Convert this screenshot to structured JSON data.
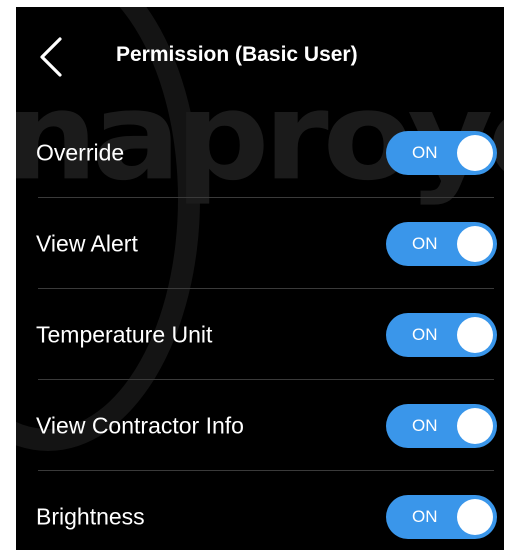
{
  "header": {
    "title": "Permission (Basic User)",
    "back_icon": "chevron-left-icon"
  },
  "watermark": "naproyec",
  "accent_color": "#3a96ea",
  "permissions": [
    {
      "label": "Override",
      "toggle_text": "ON",
      "enabled": true
    },
    {
      "label": "View Alert",
      "toggle_text": "ON",
      "enabled": true
    },
    {
      "label": "Temperature Unit",
      "toggle_text": "ON",
      "enabled": true
    },
    {
      "label": "View Contractor Info",
      "toggle_text": "ON",
      "enabled": true
    },
    {
      "label": "Brightness",
      "toggle_text": "ON",
      "enabled": true
    }
  ]
}
